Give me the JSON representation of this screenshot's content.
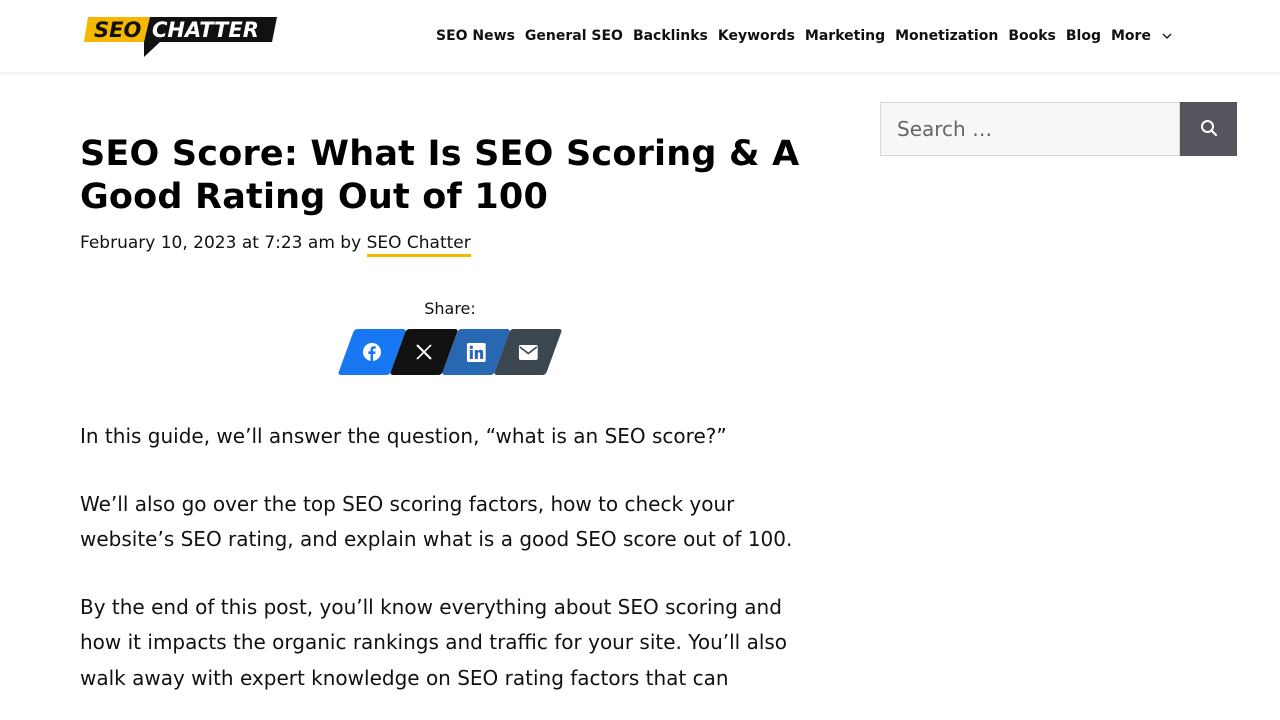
{
  "header": {
    "logo": {
      "part1": "SEO",
      "part2": "CHATTER",
      "colors": {
        "yellow": "#f5b800",
        "black": "#111111"
      }
    },
    "nav": [
      {
        "label": "SEO News"
      },
      {
        "label": "General SEO"
      },
      {
        "label": "Backlinks"
      },
      {
        "label": "Keywords"
      },
      {
        "label": "Marketing"
      },
      {
        "label": "Monetization"
      },
      {
        "label": "Books"
      },
      {
        "label": "Blog"
      },
      {
        "label": "More",
        "icon": "chevron-down-icon"
      }
    ]
  },
  "post": {
    "title": "SEO Score: What Is SEO Scoring & A Good Rating Out of 100",
    "date": "February 10, 2023 at 7:23 am",
    "by": "by",
    "author": "SEO Chatter",
    "share_label": "Share:",
    "share_buttons": [
      {
        "network": "facebook",
        "icon": "facebook-icon",
        "color": "#1877f2"
      },
      {
        "network": "x",
        "icon": "x-icon",
        "color": "#111111"
      },
      {
        "network": "linkedin",
        "icon": "linkedin-icon",
        "color": "#2867b2"
      },
      {
        "network": "email",
        "icon": "email-icon",
        "color": "#3c4650"
      }
    ],
    "paragraphs": [
      "In this guide, we’ll answer the question, “what is an SEO score?”",
      "We’ll also go over the top SEO scoring factors, how to check your website’s SEO rating, and explain what is a good SEO score out of 100.",
      "By the end of this post, you’ll know everything about SEO scoring and how it impacts the organic rankings and traffic for your site. You’ll also walk away with expert knowledge on SEO rating factors that can"
    ]
  },
  "sidebar": {
    "search": {
      "placeholder": "Search …",
      "value": "",
      "icon": "search-icon",
      "button_color": "#55555e"
    }
  }
}
